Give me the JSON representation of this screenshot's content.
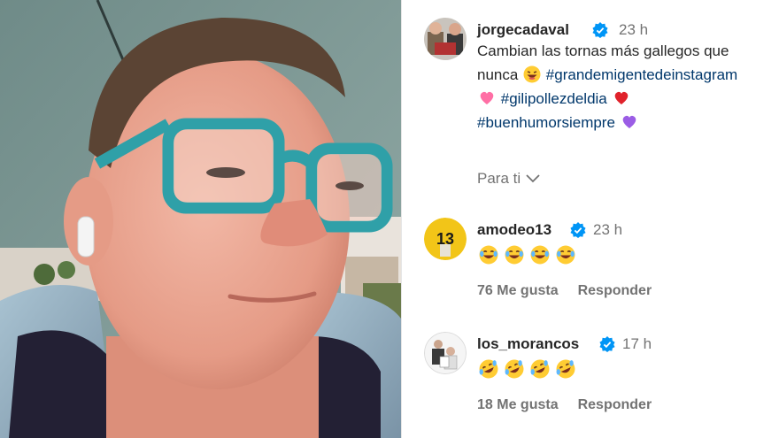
{
  "post": {
    "author": "jorgecadaval",
    "time": "23 h",
    "caption_lines": [
      {
        "text": "Cambian las tornas más gallegos que",
        "emoji": null,
        "hashtag": null
      },
      {
        "text": "nunca ",
        "emoji": "laughing",
        "hashtag": "#grandemigentedeinstagram"
      },
      {
        "emoji_before": "pink-heart",
        "hashtag": "#gilipollezdeldia",
        "emoji_after": "red-heart"
      },
      {
        "hashtag": "#buenhumorsiempre",
        "emoji_after": "purple-heart"
      }
    ],
    "l1": "Cambian las tornas más gallegos que",
    "l2": "nunca",
    "tag1": "#grandemigentedeinstagram",
    "tag2": "#gilipollezdeldia",
    "tag3": "#buenhumorsiempre",
    "para_ti": "Para ti"
  },
  "comments": [
    {
      "user": "amodeo13",
      "time": "23 h",
      "emojis": [
        "joy",
        "joy",
        "joy",
        "joy"
      ],
      "likes": "76 Me gusta",
      "reply": "Responder",
      "avatar_text": "13"
    },
    {
      "user": "los_morancos",
      "time": "17 h",
      "emojis": [
        "rofl",
        "rofl",
        "rofl",
        "rofl"
      ],
      "likes": "18 Me gusta",
      "reply": "Responder"
    }
  ],
  "colors": {
    "verified": "#0095f6",
    "hashtag": "#00376b",
    "muted": "#737373",
    "text": "#262626"
  }
}
